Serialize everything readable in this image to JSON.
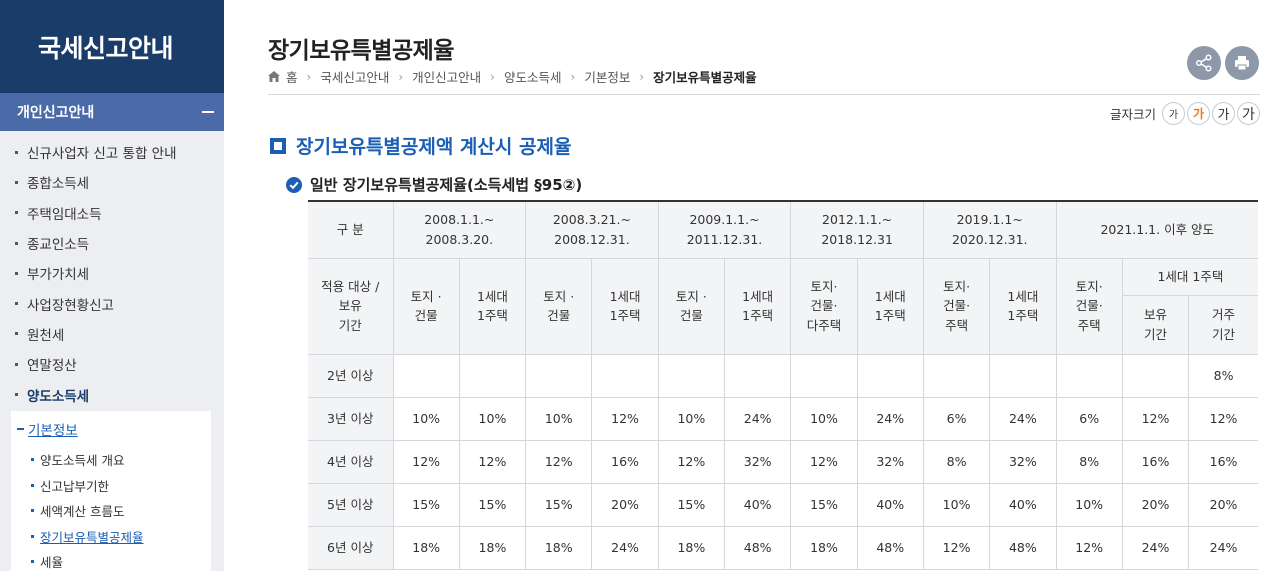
{
  "sidebar": {
    "title": "국세신고안내",
    "section": "개인신고안내",
    "items": [
      {
        "label": "신규사업자 신고 통합 안내"
      },
      {
        "label": "종합소득세"
      },
      {
        "label": "주택임대소득"
      },
      {
        "label": "종교인소득"
      },
      {
        "label": "부가가치세"
      },
      {
        "label": "사업장현황신고"
      },
      {
        "label": "원천세"
      },
      {
        "label": "연말정산"
      },
      {
        "label": "양도소득세"
      }
    ],
    "sub_head": "기본정보",
    "sub_items": [
      {
        "label": "양도소득세 개요"
      },
      {
        "label": "신고납부기한"
      },
      {
        "label": "세액계산 흐름도"
      },
      {
        "label": "장기보유특별공제율"
      },
      {
        "label": "세율"
      }
    ]
  },
  "header": {
    "title": "장기보유특별공제율",
    "breadcrumb": [
      "홈",
      "국세신고안내",
      "개인신고안내",
      "양도소득세",
      "기본정보",
      "장기보유특별공제율"
    ]
  },
  "icons": {
    "share": "share-icon",
    "print": "print-icon",
    "home": "home-icon",
    "check": "check-circle-icon"
  },
  "fontsize": {
    "label": "글자크기",
    "buttons": [
      "가",
      "가",
      "가",
      "가"
    ],
    "active_index": 1,
    "active_color": "#e87a1e"
  },
  "content": {
    "h2": "장기보유특별공제액 계산시 공제율",
    "h3": "일반 장기보유특별공제율(소득세법 §95②)"
  },
  "table": {
    "corner": "구 분",
    "periods": [
      {
        "line1": "2008.1.1.~",
        "line2": "2008.3.20."
      },
      {
        "line1": "2008.3.21.~",
        "line2": "2008.12.31."
      },
      {
        "line1": "2009.1.1.~",
        "line2": "2011.12.31."
      },
      {
        "line1": "2012.1.1.~",
        "line2": "2018.12.31"
      },
      {
        "line1": "2019.1.1~",
        "line2": "2020.12.31."
      },
      {
        "line1": "2021.1.1. 이후 양도",
        "line2": ""
      }
    ],
    "target_label": [
      "적용 대상 /",
      "보유",
      "기간"
    ],
    "subheads": {
      "land_building": [
        "토지 ·",
        "건물"
      ],
      "one_house": [
        "1세대",
        "1주택"
      ],
      "land_building_multi": [
        "토지·",
        "건물·",
        "다주택"
      ],
      "land_building_house": [
        "토지·",
        "건물·",
        "주택"
      ],
      "one_house_group": "1세대 1주택",
      "holding": [
        "보유",
        "기간"
      ],
      "residence": [
        "거주",
        "기간"
      ]
    },
    "colors": {
      "border": "#d4d7dc",
      "header_bg": "#f3f4f6",
      "accent": "#1b5fb5",
      "navy": "#1a3c68"
    },
    "rows": [
      {
        "label": "2년 이상",
        "cells": [
          "",
          "",
          "",
          "",
          "",
          "",
          "",
          "",
          "",
          "",
          "",
          "",
          "8%"
        ]
      },
      {
        "label": "3년 이상",
        "cells": [
          "10%",
          "10%",
          "10%",
          "12%",
          "10%",
          "24%",
          "10%",
          "24%",
          "6%",
          "24%",
          "6%",
          "12%",
          "12%"
        ]
      },
      {
        "label": "4년 이상",
        "cells": [
          "12%",
          "12%",
          "12%",
          "16%",
          "12%",
          "32%",
          "12%",
          "32%",
          "8%",
          "32%",
          "8%",
          "16%",
          "16%"
        ]
      },
      {
        "label": "5년 이상",
        "cells": [
          "15%",
          "15%",
          "15%",
          "20%",
          "15%",
          "40%",
          "15%",
          "40%",
          "10%",
          "40%",
          "10%",
          "20%",
          "20%"
        ]
      },
      {
        "label": "6년 이상",
        "cells": [
          "18%",
          "18%",
          "18%",
          "24%",
          "18%",
          "48%",
          "18%",
          "48%",
          "12%",
          "48%",
          "12%",
          "24%",
          "24%"
        ]
      }
    ]
  }
}
